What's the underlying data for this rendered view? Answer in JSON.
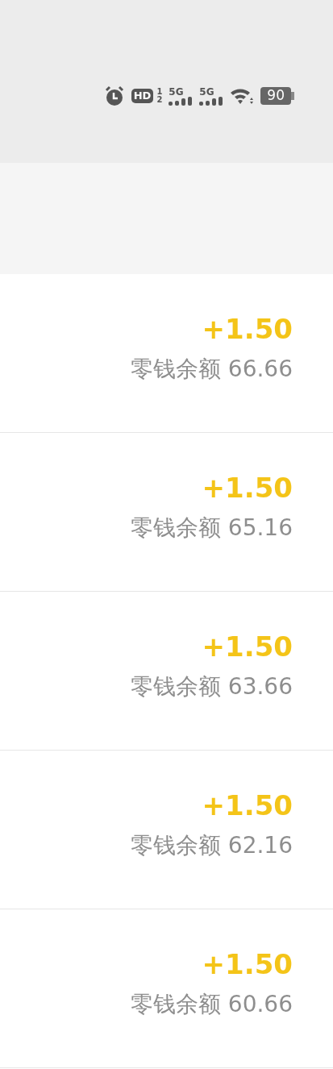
{
  "status_bar": {
    "hd": "HD",
    "sim_slots": [
      "1",
      "2"
    ],
    "networks": [
      "5G",
      "5G"
    ],
    "battery": "90"
  },
  "transactions": [
    {
      "amount": "+1.50",
      "balance": "零钱余额 66.66"
    },
    {
      "amount": "+1.50",
      "balance": "零钱余额 65.16"
    },
    {
      "amount": "+1.50",
      "balance": "零钱余额 63.66"
    },
    {
      "amount": "+1.50",
      "balance": "零钱余额 62.16"
    },
    {
      "amount": "+1.50",
      "balance": "零钱余额 60.66"
    }
  ]
}
